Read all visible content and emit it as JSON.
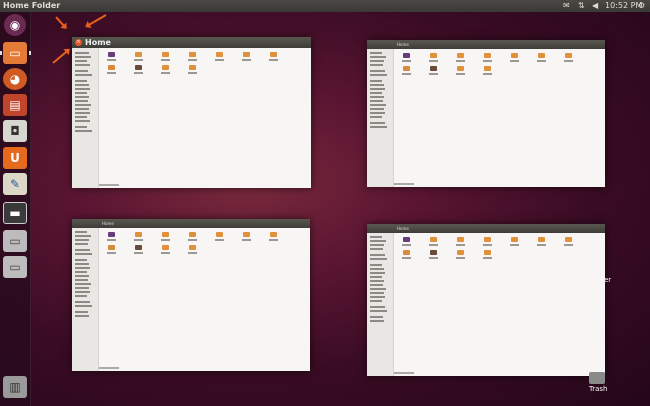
{
  "topbar": {
    "title": "Home Folder",
    "time": "10:52 PM",
    "icons": [
      "mail-icon",
      "network-icon",
      "volume-icon",
      "power-icon"
    ]
  },
  "launcher": {
    "items": [
      "dash-home-icon",
      "home-folder-icon",
      "firefox-icon",
      "libreoffice-impress-icon",
      "shotwell-icon",
      "ubuntu-one-icon",
      "writer-icon",
      "terminal-icon",
      "drive-icon",
      "drive-icon",
      "trash-icon"
    ]
  },
  "windows": [
    {
      "title": "Home",
      "close_label": "×"
    },
    {
      "title": "Home"
    },
    {
      "title": "Home"
    },
    {
      "title": "Home"
    }
  ],
  "desktop": {
    "trash_label": "Trash",
    "partial_label": "er"
  },
  "colors": {
    "accent": "#e8601c",
    "folder": "#e0913b",
    "launcher_bg": "#280a1c"
  }
}
